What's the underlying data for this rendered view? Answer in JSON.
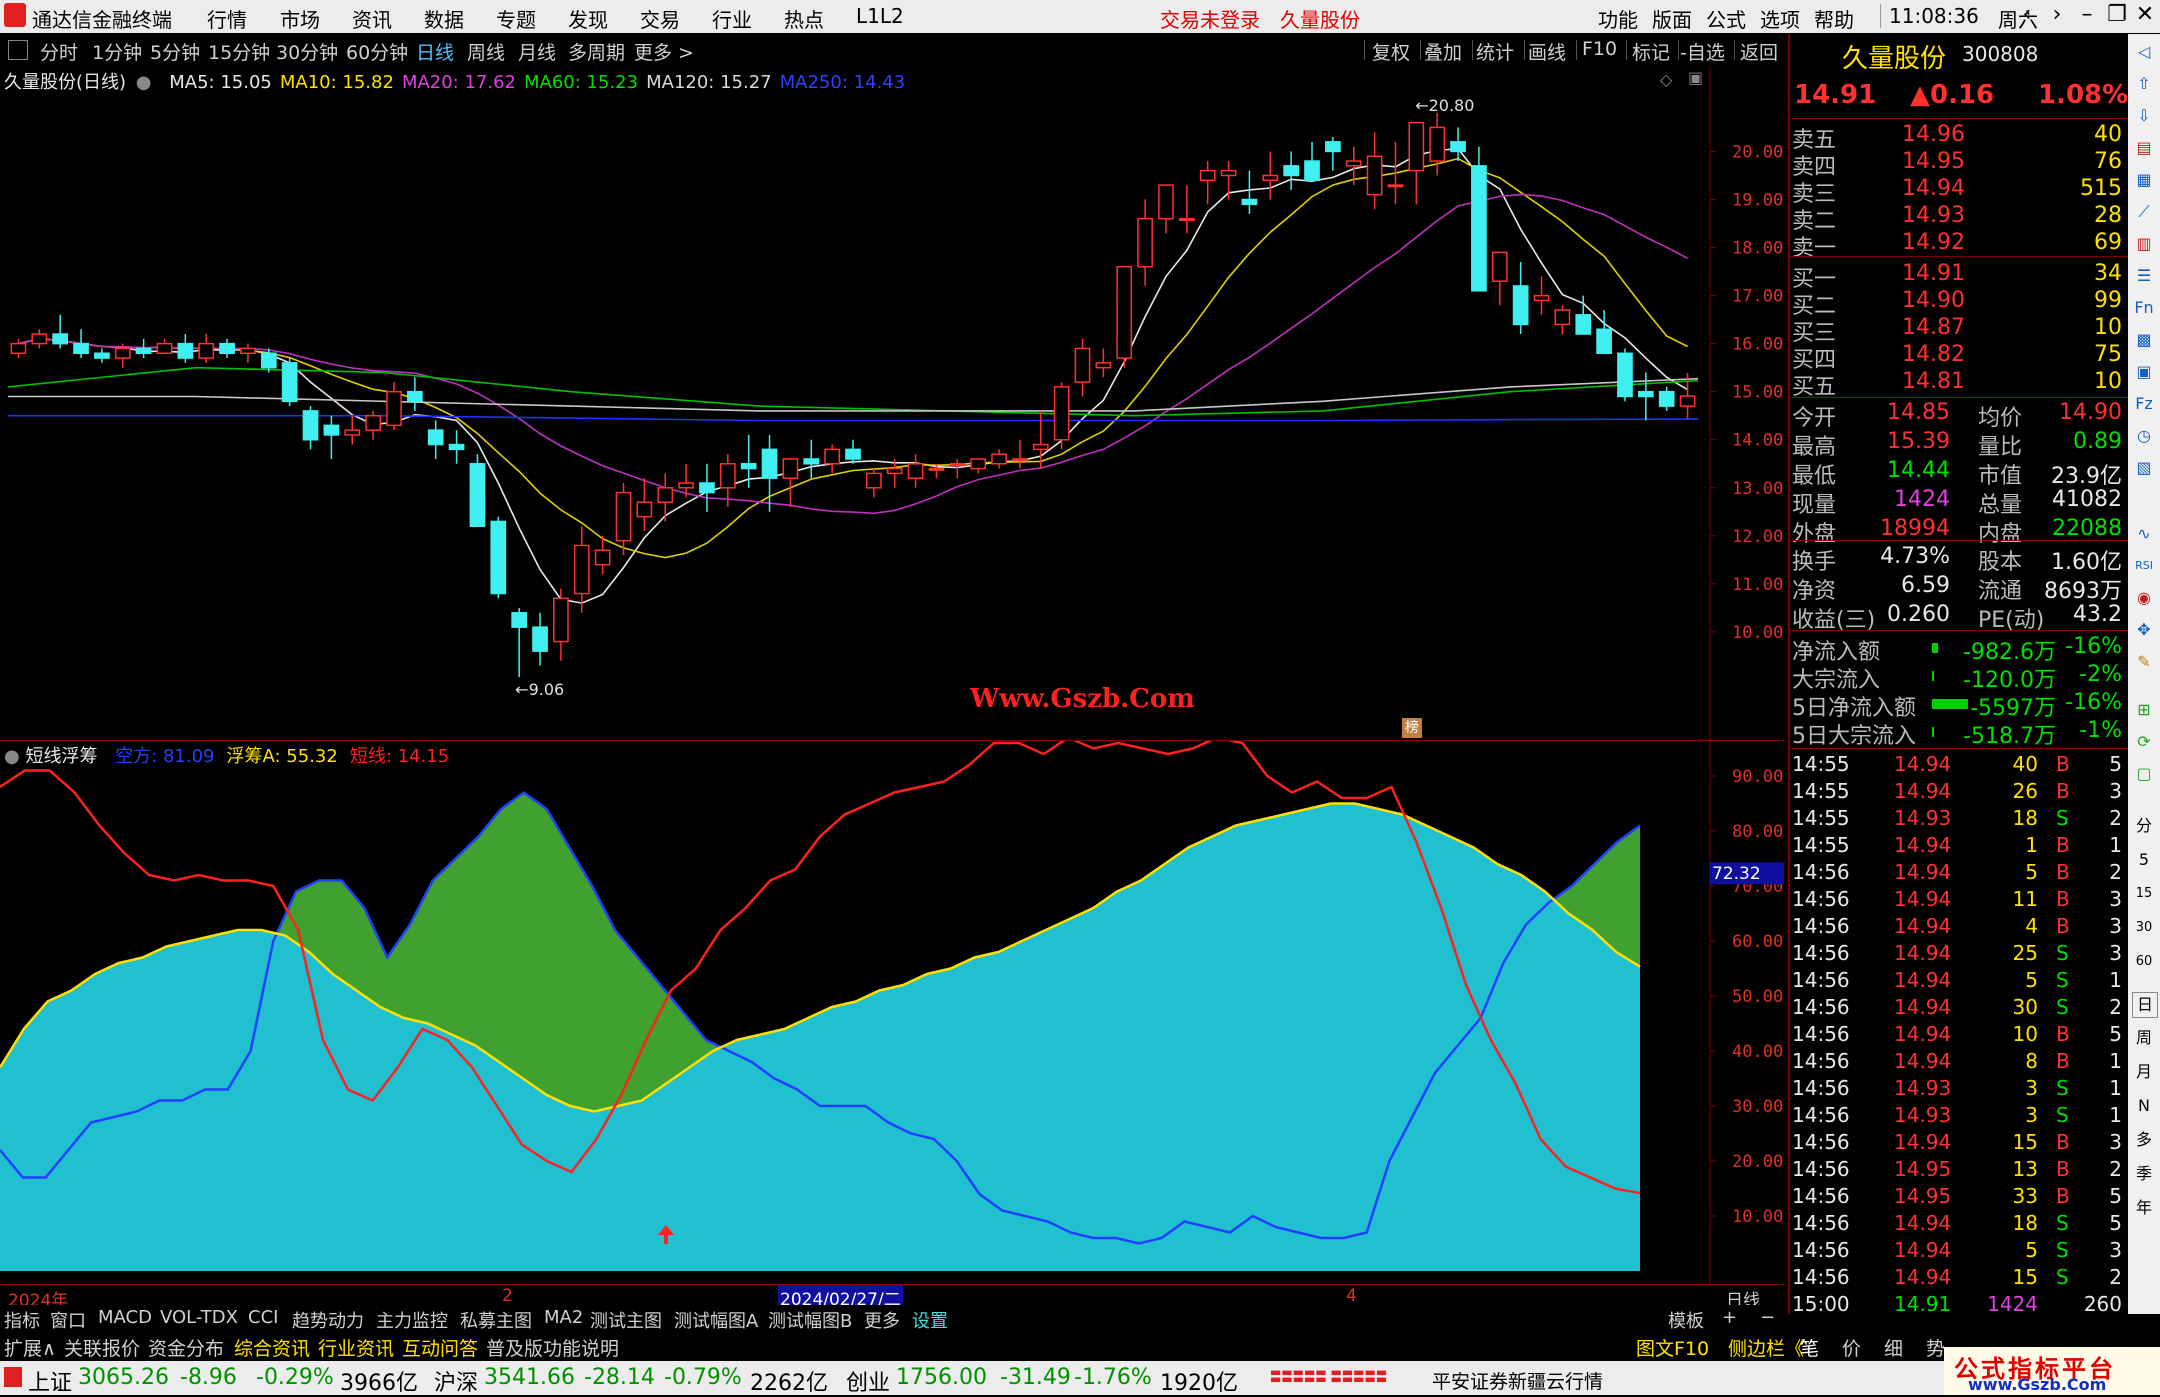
{
  "titlebar": {
    "app_name": "通达信金融终端",
    "menu": [
      "行情",
      "市场",
      "资讯",
      "数据",
      "专题",
      "发现",
      "交易",
      "行业",
      "热点",
      "L1L2"
    ],
    "trade_status": "交易未登录",
    "stock_name": "久量股份",
    "right_menu": [
      "功能",
      "版面",
      "公式",
      "选项",
      "帮助"
    ],
    "time": "11:08:36",
    "weekday": "周六"
  },
  "periodbar": {
    "tabs": [
      "分时",
      "1分钟",
      "5分钟",
      "15分钟",
      "30分钟",
      "60分钟",
      "日线",
      "周线",
      "月线",
      "多周期",
      "更多 >"
    ],
    "active": "日线",
    "tools": [
      "复权",
      "叠加",
      "统计",
      "画线",
      "F10",
      "标记",
      "-自选",
      "返回"
    ]
  },
  "main_chart": {
    "title": "久量股份(日线)",
    "ma_labels": [
      {
        "text": "MA5: 15.05",
        "color": "#e8e8e8"
      },
      {
        "text": "MA10: 15.82",
        "color": "#ffe000"
      },
      {
        "text": "MA20: 17.62",
        "color": "#e040e0"
      },
      {
        "text": "MA60: 15.23",
        "color": "#00e000"
      },
      {
        "text": "MA120: 15.27",
        "color": "#d8d8d8"
      },
      {
        "text": "MA250: 14.43",
        "color": "#3040ff"
      }
    ],
    "y_ticks": [
      "20.00",
      "19.00",
      "18.00",
      "17.00",
      "16.00",
      "15.00",
      "14.00",
      "13.00",
      "12.00",
      "11.00",
      "10.00"
    ],
    "high_marker": "20.80",
    "low_marker": "9.06",
    "watermark": "Www.Gszb.Com",
    "badge": "榜"
  },
  "indicator": {
    "name": "短线浮筹",
    "labels": [
      {
        "text": "空方: 81.09",
        "color": "#2040ff"
      },
      {
        "text": "浮筹A: 55.32",
        "color": "#ffe000"
      },
      {
        "text": "短线: 14.15",
        "color": "#ff2020"
      }
    ],
    "y_ticks": [
      "90.00",
      "80.00",
      "70.00",
      "60.00",
      "50.00",
      "40.00",
      "30.00",
      "20.00",
      "10.00"
    ],
    "current_value": "72.32"
  },
  "x_axis": {
    "labels": [
      "2024年",
      "2",
      "2024/02/27/二",
      "4"
    ],
    "period": "日线"
  },
  "chart_data": {
    "type": "candlestick",
    "dates_note": "",
    "ylim": [
      9.0,
      20.8
    ],
    "candles": [
      [
        15.8,
        16.1,
        15.7,
        16.0
      ],
      [
        16.0,
        16.3,
        15.9,
        16.2
      ],
      [
        16.2,
        16.6,
        15.9,
        16.0
      ],
      [
        16.0,
        16.3,
        15.7,
        15.8
      ],
      [
        15.8,
        15.9,
        15.6,
        15.7
      ],
      [
        15.7,
        16.0,
        15.5,
        15.9
      ],
      [
        15.9,
        16.1,
        15.7,
        15.8
      ],
      [
        15.8,
        16.1,
        15.8,
        16.0
      ],
      [
        16.0,
        16.2,
        15.6,
        15.7
      ],
      [
        15.7,
        16.2,
        15.6,
        16.0
      ],
      [
        16.0,
        16.1,
        15.7,
        15.8
      ],
      [
        15.8,
        16.0,
        15.6,
        15.9
      ],
      [
        15.8,
        15.9,
        15.4,
        15.5
      ],
      [
        15.6,
        15.7,
        14.7,
        14.8
      ],
      [
        14.6,
        14.7,
        13.8,
        14.0
      ],
      [
        14.3,
        14.5,
        13.6,
        14.1
      ],
      [
        14.1,
        14.5,
        13.9,
        14.2
      ],
      [
        14.2,
        14.6,
        14.0,
        14.5
      ],
      [
        14.3,
        15.2,
        14.2,
        15.0
      ],
      [
        15.0,
        15.3,
        14.6,
        14.8
      ],
      [
        14.2,
        14.4,
        13.6,
        13.9
      ],
      [
        13.9,
        14.2,
        13.5,
        13.8
      ],
      [
        13.5,
        13.7,
        12.2,
        12.2
      ],
      [
        12.3,
        12.4,
        10.7,
        10.8
      ],
      [
        10.4,
        10.5,
        9.06,
        10.1
      ],
      [
        10.1,
        10.4,
        9.3,
        9.6
      ],
      [
        9.8,
        10.9,
        9.4,
        10.7
      ],
      [
        10.8,
        12.2,
        10.4,
        11.8
      ],
      [
        11.4,
        12.0,
        11.2,
        11.7
      ],
      [
        11.9,
        13.1,
        11.6,
        12.9
      ],
      [
        12.4,
        13.2,
        12.1,
        12.7
      ],
      [
        12.7,
        13.3,
        12.3,
        13.0
      ],
      [
        13.0,
        13.5,
        12.8,
        13.1
      ],
      [
        13.1,
        13.5,
        12.5,
        12.9
      ],
      [
        13.0,
        13.7,
        12.6,
        13.5
      ],
      [
        13.5,
        14.1,
        13.0,
        13.4
      ],
      [
        13.8,
        14.1,
        12.5,
        13.2
      ],
      [
        13.2,
        13.6,
        12.6,
        13.6
      ],
      [
        13.6,
        14.0,
        13.2,
        13.5
      ],
      [
        13.5,
        13.9,
        13.3,
        13.8
      ],
      [
        13.8,
        14.0,
        13.5,
        13.6
      ],
      [
        13.0,
        13.4,
        12.8,
        13.3
      ],
      [
        13.3,
        13.6,
        13.0,
        13.4
      ],
      [
        13.2,
        13.7,
        13.0,
        13.5
      ],
      [
        13.4,
        13.5,
        13.2,
        13.4
      ],
      [
        13.5,
        13.6,
        13.2,
        13.5
      ],
      [
        13.4,
        13.6,
        13.3,
        13.6
      ],
      [
        13.5,
        13.8,
        13.4,
        13.7
      ],
      [
        13.6,
        14.0,
        13.4,
        13.6
      ],
      [
        13.8,
        14.6,
        13.4,
        13.9
      ],
      [
        14.0,
        15.2,
        13.8,
        15.1
      ],
      [
        15.2,
        16.1,
        14.9,
        15.9
      ],
      [
        15.5,
        15.9,
        15.3,
        15.6
      ],
      [
        15.7,
        17.6,
        15.5,
        17.6
      ],
      [
        17.6,
        19.0,
        17.2,
        18.6
      ],
      [
        18.6,
        19.3,
        18.3,
        19.3
      ],
      [
        18.6,
        19.3,
        18.3,
        18.6
      ],
      [
        19.4,
        19.8,
        18.9,
        19.6
      ],
      [
        19.5,
        19.8,
        19.0,
        19.6
      ],
      [
        19.0,
        19.6,
        18.7,
        18.9
      ],
      [
        19.4,
        20.0,
        19.0,
        19.5
      ],
      [
        19.7,
        20.0,
        19.2,
        19.5
      ],
      [
        19.8,
        20.2,
        19.4,
        19.4
      ],
      [
        20.2,
        20.3,
        19.6,
        20.0
      ],
      [
        19.7,
        20.1,
        19.3,
        19.8
      ],
      [
        19.1,
        20.4,
        18.8,
        19.9
      ],
      [
        19.3,
        20.2,
        18.9,
        19.3
      ],
      [
        19.6,
        20.6,
        18.9,
        20.6
      ],
      [
        19.8,
        20.8,
        19.5,
        20.5
      ],
      [
        20.2,
        20.5,
        19.8,
        20.0
      ],
      [
        19.7,
        20.1,
        17.1,
        17.1
      ],
      [
        17.3,
        17.9,
        16.8,
        17.9
      ],
      [
        17.2,
        17.7,
        16.2,
        16.4
      ],
      [
        16.9,
        17.4,
        16.6,
        17.0
      ],
      [
        16.4,
        16.8,
        16.2,
        16.7
      ],
      [
        16.6,
        17.0,
        16.3,
        16.2
      ],
      [
        16.3,
        16.7,
        15.8,
        15.8
      ],
      [
        15.8,
        15.9,
        14.8,
        14.9
      ],
      [
        15.0,
        15.4,
        14.4,
        14.9
      ],
      [
        15.0,
        15.1,
        14.6,
        14.7
      ],
      [
        14.7,
        15.39,
        14.44,
        14.91
      ]
    ],
    "indicator_series": [
      {
        "name": "空方",
        "color": "#2040ff",
        "values": [
          22,
          17,
          17,
          22,
          27,
          28,
          29,
          31,
          31,
          33,
          33,
          40,
          60,
          69,
          71,
          71,
          66,
          57,
          63,
          71,
          75,
          79,
          84,
          87,
          84,
          77,
          70,
          62,
          57,
          52,
          47,
          42,
          40,
          38,
          35,
          33,
          30,
          30,
          30,
          27,
          25,
          24,
          20,
          14,
          11,
          10,
          9,
          7,
          6,
          6,
          5,
          6,
          9,
          8,
          7,
          10,
          8,
          7,
          6,
          6,
          7,
          20,
          28,
          36,
          41,
          46,
          56,
          63,
          67,
          70,
          74,
          78,
          81
        ]
      },
      {
        "name": "浮筹A",
        "color": "#ffe000",
        "values": [
          37,
          44,
          49,
          51,
          54,
          56,
          57,
          59,
          60,
          61,
          62,
          62,
          61,
          58,
          54,
          51,
          48,
          46,
          45,
          43,
          41,
          38,
          35,
          32,
          30,
          29,
          30,
          31,
          34,
          37,
          40,
          42,
          43,
          44,
          46,
          48,
          49,
          51,
          52,
          54,
          55,
          57,
          58,
          60,
          62,
          64,
          66,
          69,
          71,
          74,
          77,
          79,
          81,
          82,
          83,
          84,
          85,
          85,
          84,
          83,
          81,
          79,
          77,
          74,
          72,
          69,
          65,
          62,
          58,
          55.32
        ]
      },
      {
        "name": "短线",
        "color": "#ff2020",
        "values": [
          88,
          91,
          91,
          87,
          81,
          76,
          72,
          71,
          72,
          71,
          71,
          70,
          62,
          42,
          33,
          31,
          37,
          44,
          42,
          37,
          30,
          23,
          20,
          18,
          24,
          32,
          42,
          51,
          55,
          62,
          66,
          71,
          73,
          79,
          83,
          85,
          87,
          88,
          89,
          92,
          96,
          96,
          94,
          97,
          95,
          96,
          95,
          94,
          95,
          97,
          96,
          90,
          87,
          89,
          86,
          86,
          88,
          78,
          66,
          52,
          42,
          34,
          24,
          19,
          17,
          15,
          14.15
        ]
      }
    ]
  },
  "quote": {
    "name": "久量股份",
    "code": "300808",
    "price": "14.91",
    "change": "▲0.16",
    "pct": "1.08%",
    "asks": [
      {
        "label": "卖五",
        "price": "14.96",
        "vol": "40"
      },
      {
        "label": "卖四",
        "price": "14.95",
        "vol": "76"
      },
      {
        "label": "卖三",
        "price": "14.94",
        "vol": "515"
      },
      {
        "label": "卖二",
        "price": "14.93",
        "vol": "28"
      },
      {
        "label": "卖一",
        "price": "14.92",
        "vol": "69"
      }
    ],
    "bids": [
      {
        "label": "买一",
        "price": "14.91",
        "vol": "34"
      },
      {
        "label": "买二",
        "price": "14.90",
        "vol": "99"
      },
      {
        "label": "买三",
        "price": "14.87",
        "vol": "10"
      },
      {
        "label": "买四",
        "price": "14.82",
        "vol": "75"
      },
      {
        "label": "买五",
        "price": "14.81",
        "vol": "10"
      }
    ],
    "stats": [
      {
        "l1": "今开",
        "v1": "14.85",
        "c1": "red",
        "l2": "均价",
        "v2": "14.90",
        "c2": "red"
      },
      {
        "l1": "最高",
        "v1": "15.39",
        "c1": "red",
        "l2": "量比",
        "v2": "0.89",
        "c2": "green"
      },
      {
        "l1": "最低",
        "v1": "14.44",
        "c1": "green",
        "l2": "市值",
        "v2": "23.9亿",
        "c2": "white"
      },
      {
        "l1": "现量",
        "v1": "1424",
        "c1": "magenta",
        "l2": "总量",
        "v2": "41082",
        "c2": "white"
      },
      {
        "l1": "外盘",
        "v1": "18994",
        "c1": "red",
        "l2": "内盘",
        "v2": "22088",
        "c2": "green"
      }
    ],
    "fund": [
      {
        "l1": "换手",
        "v1": "4.73%",
        "l2": "股本",
        "v2": "1.60亿"
      },
      {
        "l1": "净资",
        "v1": "6.59",
        "l2": "流通",
        "v2": "8693万"
      },
      {
        "l1": "收益(三)",
        "v1": "0.260",
        "l2": "PE(动)",
        "v2": "43.2"
      }
    ],
    "flows": [
      {
        "label": "净流入额",
        "value": "-982.6万",
        "pct": "-16%"
      },
      {
        "label": "大宗流入",
        "value": "-120.0万",
        "pct": "-2%"
      },
      {
        "label": "5日净流入额",
        "value": "-5597万",
        "pct": "-16%"
      },
      {
        "label": "5日大宗流入",
        "value": "-518.7万",
        "pct": "-1%"
      }
    ],
    "ticks": [
      {
        "t": "14:55",
        "p": "14.94",
        "v": "40",
        "s": "B",
        "n": "5"
      },
      {
        "t": "14:55",
        "p": "14.94",
        "v": "26",
        "s": "B",
        "n": "3"
      },
      {
        "t": "14:55",
        "p": "14.93",
        "v": "18",
        "s": "S",
        "n": "2"
      },
      {
        "t": "14:55",
        "p": "14.94",
        "v": "1",
        "s": "B",
        "n": "1"
      },
      {
        "t": "14:56",
        "p": "14.94",
        "v": "5",
        "s": "B",
        "n": "2"
      },
      {
        "t": "14:56",
        "p": "14.94",
        "v": "11",
        "s": "B",
        "n": "3"
      },
      {
        "t": "14:56",
        "p": "14.94",
        "v": "4",
        "s": "B",
        "n": "3"
      },
      {
        "t": "14:56",
        "p": "14.94",
        "v": "25",
        "s": "S",
        "n": "3"
      },
      {
        "t": "14:56",
        "p": "14.94",
        "v": "5",
        "s": "S",
        "n": "1"
      },
      {
        "t": "14:56",
        "p": "14.94",
        "v": "30",
        "s": "S",
        "n": "2"
      },
      {
        "t": "14:56",
        "p": "14.94",
        "v": "10",
        "s": "B",
        "n": "5"
      },
      {
        "t": "14:56",
        "p": "14.94",
        "v": "8",
        "s": "B",
        "n": "1"
      },
      {
        "t": "14:56",
        "p": "14.93",
        "v": "3",
        "s": "S",
        "n": "1"
      },
      {
        "t": "14:56",
        "p": "14.93",
        "v": "3",
        "s": "S",
        "n": "1"
      },
      {
        "t": "14:56",
        "p": "14.94",
        "v": "15",
        "s": "B",
        "n": "3"
      },
      {
        "t": "14:56",
        "p": "14.95",
        "v": "13",
        "s": "B",
        "n": "2"
      },
      {
        "t": "14:56",
        "p": "14.95",
        "v": "33",
        "s": "B",
        "n": "5"
      },
      {
        "t": "14:56",
        "p": "14.94",
        "v": "18",
        "s": "S",
        "n": "5"
      },
      {
        "t": "14:56",
        "p": "14.94",
        "v": "5",
        "s": "S",
        "n": "3"
      },
      {
        "t": "14:56",
        "p": "14.94",
        "v": "15",
        "s": "S",
        "n": "2"
      },
      {
        "t": "15:00",
        "p": "14.91",
        "v": "1424",
        "s": "",
        "n": "260"
      }
    ]
  },
  "sidetools_right": [
    "分",
    "5",
    "15",
    "30",
    "60",
    "日",
    "周",
    "月",
    "N",
    "多",
    "季",
    "年"
  ],
  "indicator_tabs": [
    "指标",
    "窗口",
    "MACD",
    "VOL-TDX",
    "CCI",
    "趋势动力",
    "主力监控",
    "私募主图",
    "MA2",
    "测试主图",
    "测试幅图A",
    "测试幅图B",
    "更多",
    "设置"
  ],
  "indicator_tabs_right": [
    "模板",
    "+",
    "−"
  ],
  "bottom_tabs": [
    "扩展∧",
    "关联报价",
    "资金分布",
    "综合资讯",
    "行业资讯",
    "互动问答",
    "普及版功能说明"
  ],
  "bottom_right": [
    "图文F10",
    "侧边栏《",
    "笔",
    "价",
    "细",
    "势"
  ],
  "status": {
    "sh_label": "上证",
    "sh_val": "3065.26",
    "sh_chg": "-8.96",
    "sh_pct": "-0.29%",
    "sh_amt": "3966亿",
    "sz_label": "沪深",
    "sz_val": "3541.66",
    "sz_chg": "-28.14",
    "sz_pct": "-0.79%",
    "sz_amt": "2262亿",
    "cy_label": "创业",
    "cy_val": "1756.00",
    "cy_chg": "-31.49",
    "cy_pct": "-1.76%",
    "cy_amt": "1920亿",
    "server": "平安证券新疆云行情",
    "brand": "公式指标平台",
    "brand_url": "www.Gszb.Com"
  }
}
